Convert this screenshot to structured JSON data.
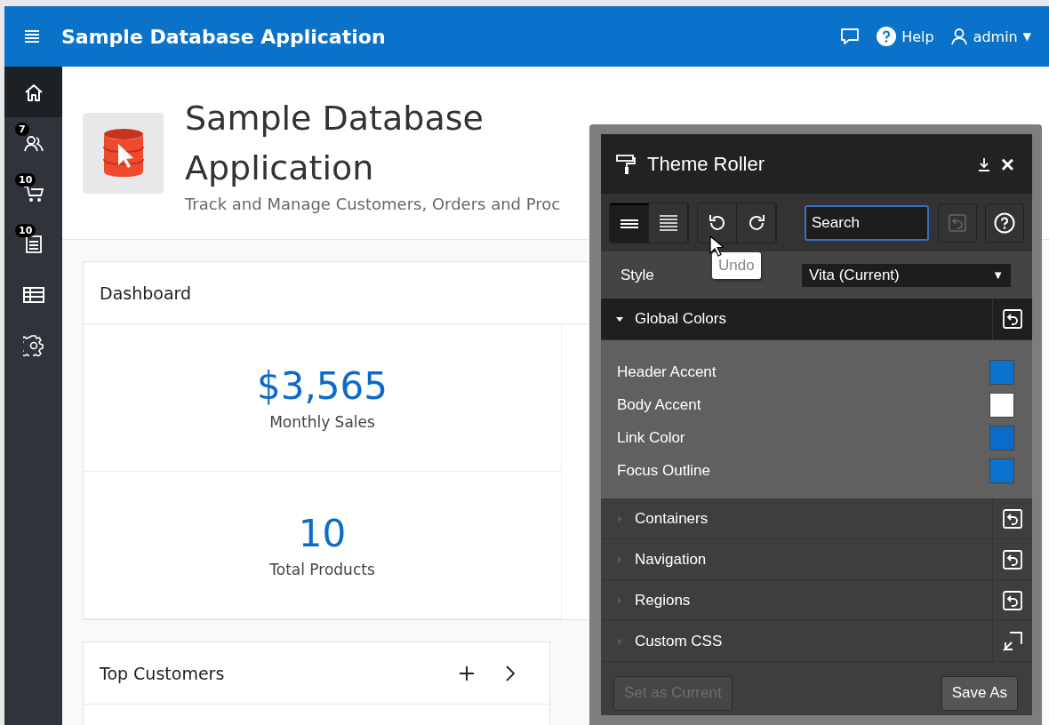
{
  "header": {
    "title": "Sample Database Application",
    "help": "Help",
    "user": "admin",
    "user_caret": "▼"
  },
  "sidebar": {
    "items": [
      {
        "kind": "home",
        "selected": true
      },
      {
        "kind": "people",
        "badge": "7",
        "selected": false
      },
      {
        "kind": "cart",
        "badge": "10",
        "selected": false
      },
      {
        "kind": "list",
        "badge": "10",
        "selected": false
      },
      {
        "kind": "grid",
        "selected": false
      },
      {
        "kind": "gear",
        "selected": false
      }
    ]
  },
  "hero": {
    "title": "Sample Database Application",
    "subtitle": "Track and Manage Customers, Orders and Proc"
  },
  "dashboard": {
    "title": "Dashboard",
    "stats": [
      {
        "value": "$3,565",
        "label": "Monthly Sales"
      },
      {
        "value": "10",
        "label": "Total Products"
      }
    ]
  },
  "cards": [
    {
      "title": "Top Customers",
      "actions": true
    }
  ],
  "theme_roller": {
    "title": "Theme Roller",
    "close": "×",
    "views": [
      {
        "kind": "compact",
        "selected": true
      },
      {
        "kind": "full",
        "selected": false
      }
    ],
    "search": {
      "placeholder": "Search"
    },
    "tooltip": "Undo",
    "style_label": "Style",
    "style_value": "Vita (Current)",
    "style_caret": "▼",
    "sections": [
      {
        "label": "Global Colors",
        "expanded": true,
        "kind": "reset",
        "colors": [
          {
            "label": "Header Accent",
            "color": "#0a72d0"
          },
          {
            "label": "Body Accent",
            "color": "#ffffff"
          },
          {
            "label": "Link Color",
            "color": "#0b6bc8"
          },
          {
            "label": "Focus Outline",
            "color": "#0a72d0"
          }
        ]
      },
      {
        "label": "Containers",
        "expanded": false,
        "kind": "reset"
      },
      {
        "label": "Navigation",
        "expanded": false,
        "kind": "reset"
      },
      {
        "label": "Regions",
        "expanded": false,
        "kind": "reset"
      },
      {
        "label": "Custom CSS",
        "expanded": false,
        "kind": "popout"
      }
    ],
    "buttons": [
      {
        "label": "Set as Current",
        "disabled": true
      },
      {
        "label": "Save As",
        "disabled": false
      }
    ]
  }
}
